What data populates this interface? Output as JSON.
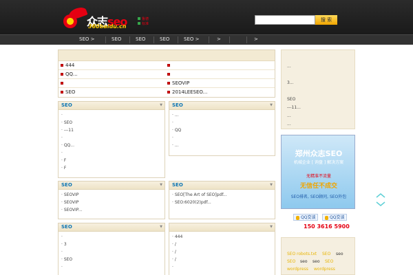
{
  "brand": {
    "wordmark_main": "众志",
    "wordmark_seo": "seo",
    "domain": "360baidu.cn",
    "badge": [
      "鲁",
      "德",
      "标",
      "准"
    ]
  },
  "search": {
    "placeholder": "",
    "button_label": "搜 索"
  },
  "nav": {
    "items": [
      "SEO >",
      "SEO",
      "SEO",
      "SEO",
      "SEO >",
      ">",
      "",
      ">"
    ]
  },
  "top_list": {
    "left": [
      "444",
      "QQ...",
      "",
      "SEO"
    ],
    "right": [
      "",
      "",
      "SEOVIP",
      "2014LEESEO..."
    ]
  },
  "panels": [
    {
      "title": "SEO",
      "items": [
        "·",
        "· SEO",
        "· ---11",
        "·",
        "· QQ...",
        "·",
        "· F",
        "· F"
      ]
    },
    {
      "title": "SEO",
      "items": [
        "· ...",
        "·",
        "· QQ",
        "·",
        "· ..."
      ]
    },
    {
      "title": "SEO",
      "items": [
        "· SEOVIP",
        "· SEOVIP",
        "· SEOVIP..."
      ]
    },
    {
      "title": "SEO",
      "items": [
        "· SEO[The Art of SEO]pdf...",
        "· SEO:6020(2)pdf..."
      ]
    },
    {
      "title": "SEO",
      "items": [
        "·",
        "· 3",
        "·",
        "· SEO",
        "·"
      ]
    },
    {
      "title": "",
      "items": [
        "· 444",
        "· /",
        "· /",
        "· /",
        "·"
      ]
    }
  ],
  "sidebar_top": {
    "lines": [
      "...",
      "3...",
      "SEO",
      "---11...",
      "...",
      "..."
    ]
  },
  "ad": {
    "title": "郑州众志SEO",
    "subtitle": "机械企业 [ 询盘 ] 解决方案",
    "line1": "无精准不流量",
    "line2": "无信任不成交",
    "line3": "SEO排名, SEO顾问, SEO外包"
  },
  "contact": {
    "qq1": "QQ交谈",
    "qq2": "QQ交谈",
    "phone": "150 3616 5900"
  },
  "tags": [
    {
      "text": "SEO",
      "color": "#e8b400"
    },
    {
      "text": "robots.txt",
      "color": "#e8b400"
    },
    {
      "text": "SEO",
      "color": "#e8b400"
    },
    {
      "text": "seo",
      "color": "#333333"
    },
    {
      "text": "SEO",
      "color": "#e8b400"
    },
    {
      "text": "seo",
      "color": "#333333"
    },
    {
      "text": "seo",
      "color": "#333333"
    },
    {
      "text": "SEO",
      "color": "#e8b400"
    },
    {
      "text": "wordpress",
      "color": "#e8b400"
    },
    {
      "text": "wordpress",
      "color": "#e8b400"
    }
  ],
  "colors": {
    "accent": "#e50012",
    "title_blue": "#0b74b3",
    "panel_bg": "#f5efe0"
  }
}
